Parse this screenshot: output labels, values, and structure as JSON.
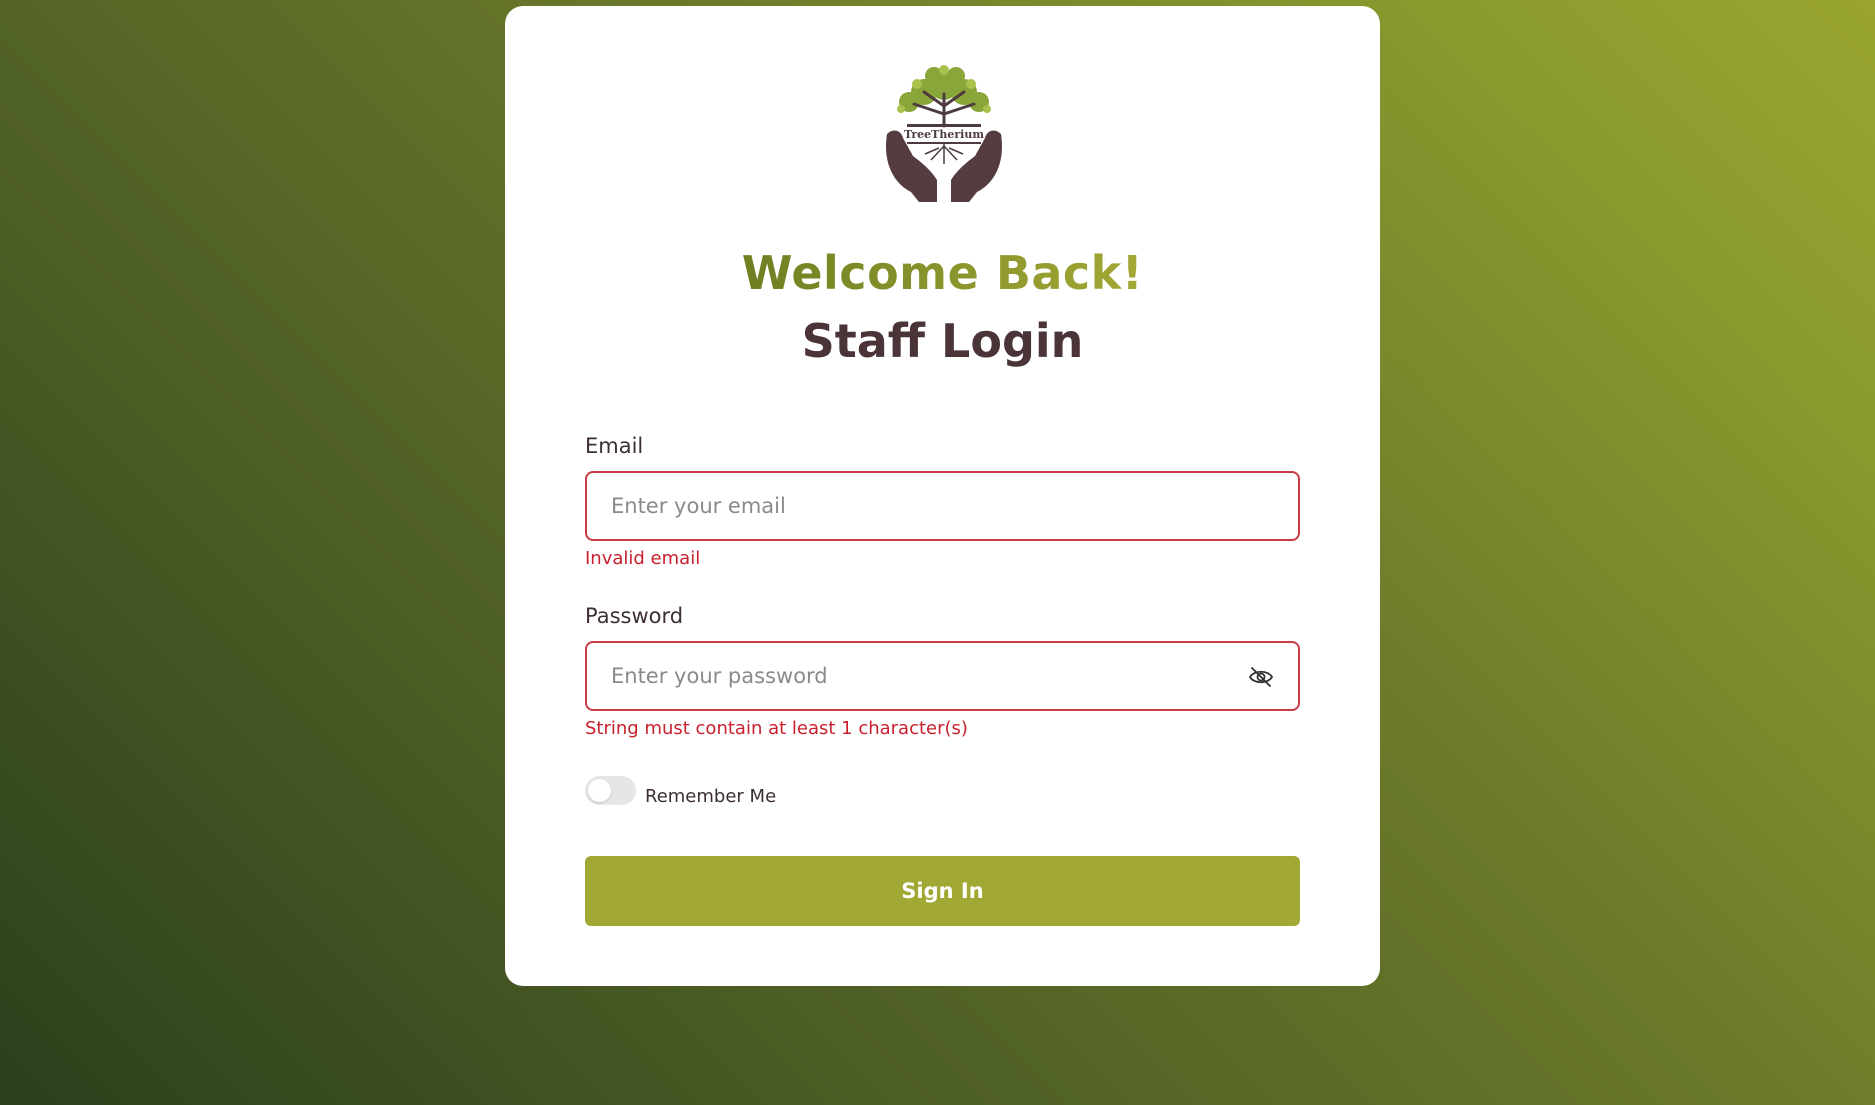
{
  "logo": {
    "text": "TreeTherium",
    "icon": "tree-in-hands-logo"
  },
  "header": {
    "welcome": "Welcome Back!",
    "title": "Staff Login"
  },
  "form": {
    "email": {
      "label": "Email",
      "placeholder": "Enter your email",
      "value": "",
      "error": "Invalid email"
    },
    "password": {
      "label": "Password",
      "placeholder": "Enter your password",
      "value": "",
      "error": "String must contain at least 1 character(s)",
      "visibility_icon": "eye-off-icon"
    },
    "remember_me": {
      "label": "Remember Me",
      "checked": false
    },
    "submit_label": "Sign In"
  },
  "colors": {
    "accent": "#a2a834",
    "title": "#4b3438",
    "error": "#c8202d"
  }
}
